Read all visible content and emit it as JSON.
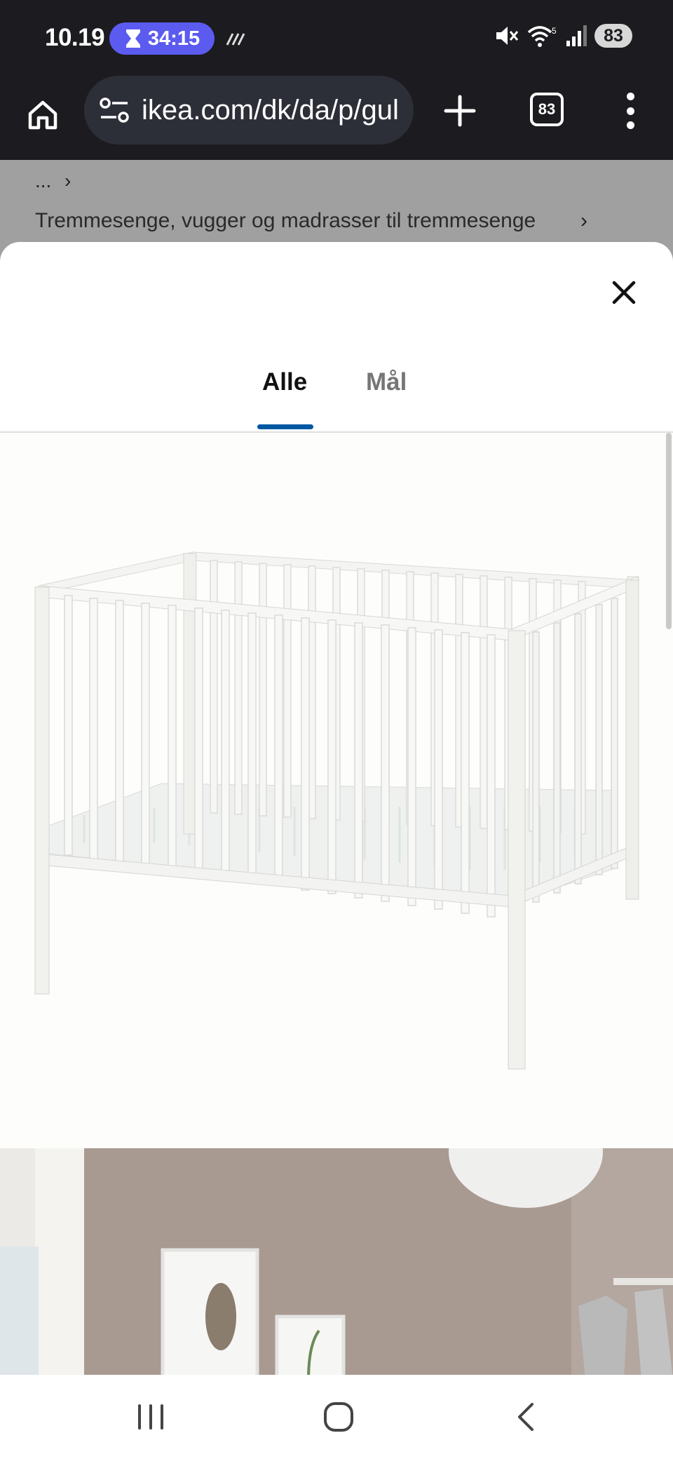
{
  "status_bar": {
    "time": "10.19",
    "timer": "34:15",
    "battery": "83"
  },
  "browser": {
    "url": "ikea.com/dk/da/p/gul",
    "tab_count": "83"
  },
  "page_behind": {
    "breadcrumb_more": "...",
    "breadcrumb_category": "Tremmesenge, vugger og madrasser til tremmesenge",
    "chevron": "›"
  },
  "sheet": {
    "tabs": [
      {
        "label": "Alle",
        "selected": true
      },
      {
        "label": "Mål",
        "selected": false
      }
    ],
    "images": [
      {
        "subject": "white-baby-crib-with-mattress"
      },
      {
        "subject": "nursery-room-with-crib"
      }
    ]
  },
  "colors": {
    "accent": "#0058a3",
    "timer_chip": "#5b5bf0",
    "chrome_bg": "#1c1b1f"
  }
}
